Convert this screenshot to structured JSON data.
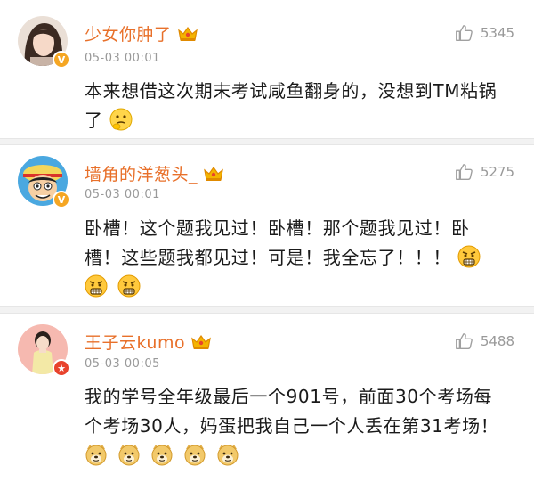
{
  "comments": [
    {
      "username": "少女你肿了",
      "time": "05-03 00:01",
      "likes": "5345",
      "badge_icon": "verified-v-icon",
      "text": "本来想借这次期末考试咸鱼翻身的，没想到TM粘锅了",
      "emoji": [
        "thinking-emoji"
      ]
    },
    {
      "username": "墙角的洋葱头_",
      "time": "05-03 00:01",
      "likes": "5275",
      "badge_icon": "verified-v-icon",
      "text": "卧槽！这个题我见过！卧槽！那个题我见过！卧槽！这些题我都见过！可是！我全忘了！！！",
      "emoji": [
        "angry-emoji",
        "angry-emoji",
        "angry-emoji"
      ]
    },
    {
      "username": "王子云kumo",
      "time": "05-03 00:05",
      "likes": "5488",
      "badge_icon": "star-badge-icon",
      "text": "我的学号全年级最后一个901号，前面30个考场每个考场30人，妈蛋把我自己一个人丢在第31考场！",
      "emoji": [
        "doge-emoji",
        "doge-emoji",
        "doge-emoji",
        "doge-emoji",
        "doge-emoji"
      ]
    }
  ],
  "colors": {
    "username": "#e8702a",
    "meta": "#999999",
    "verified": "#f5a623",
    "star_badge": "#e8432d"
  }
}
